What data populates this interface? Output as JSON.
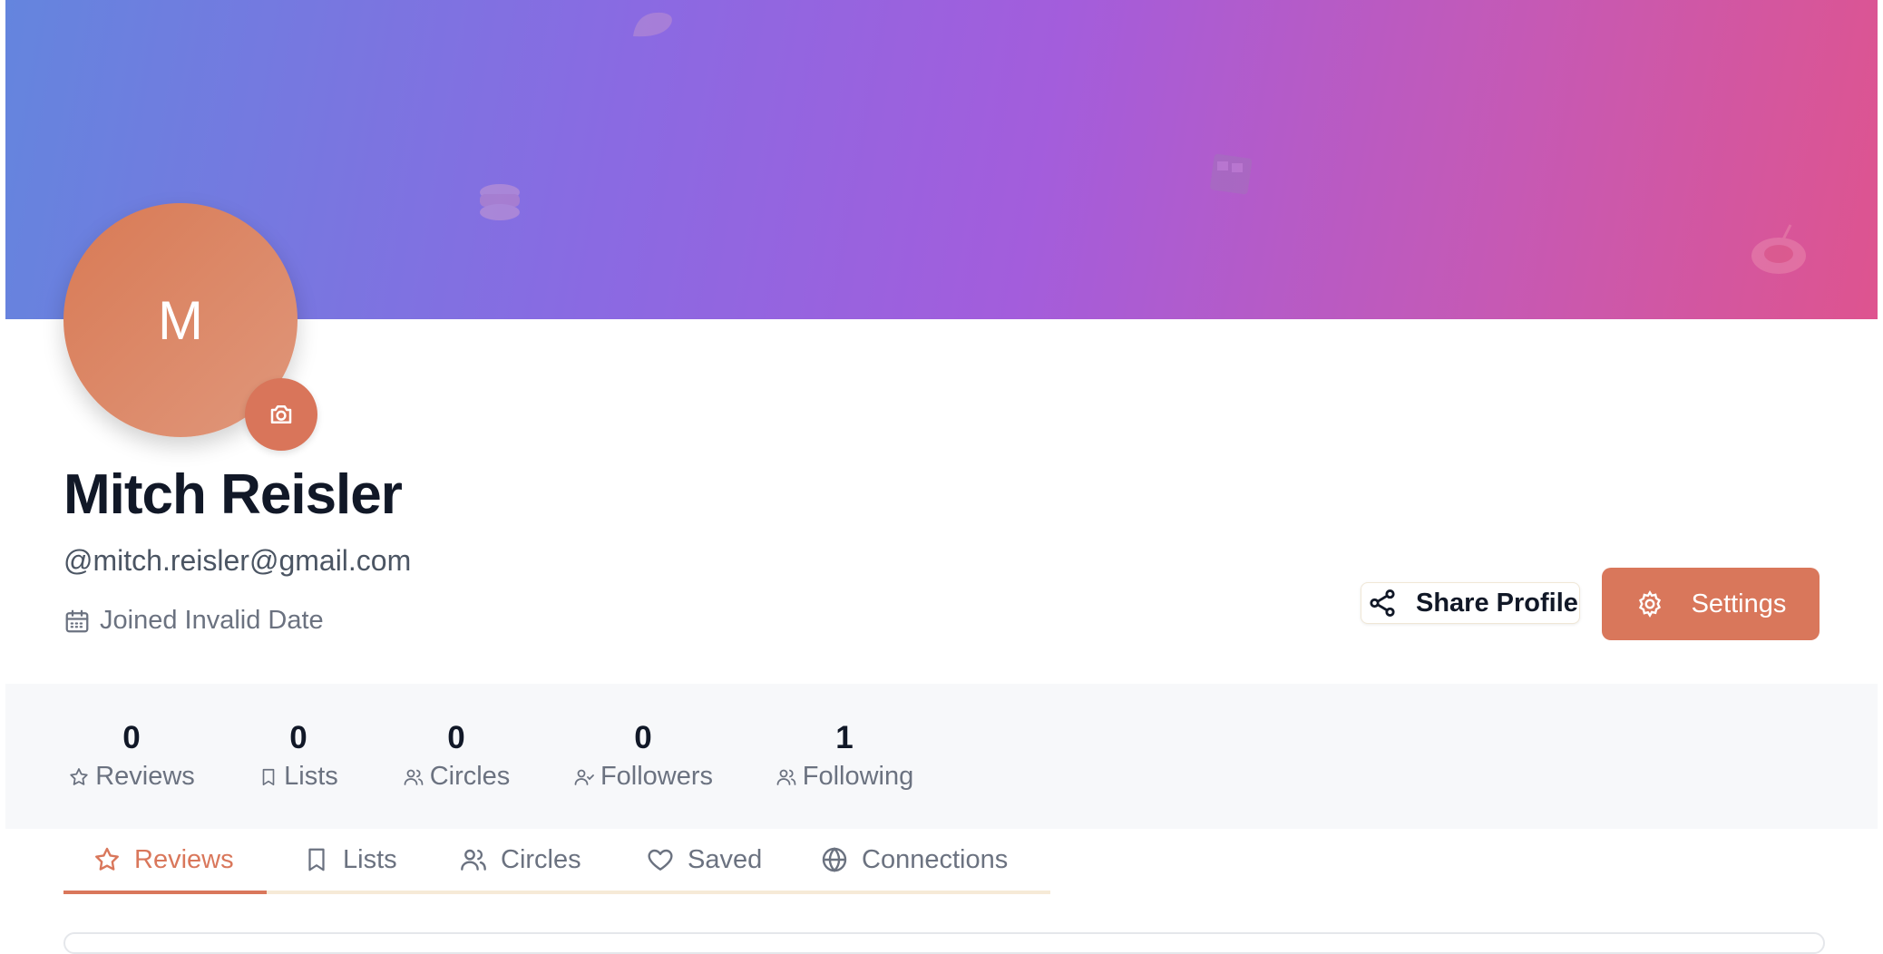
{
  "profile": {
    "avatar_initial": "M",
    "name": "Mitch Reisler",
    "handle": "@mitch.reisler@gmail.com",
    "joined": "Joined Invalid Date"
  },
  "actions": {
    "share_label": "Share Profile",
    "settings_label": "Settings"
  },
  "stats": [
    {
      "value": "0",
      "label": "Reviews"
    },
    {
      "value": "0",
      "label": "Lists"
    },
    {
      "value": "0",
      "label": "Circles"
    },
    {
      "value": "0",
      "label": "Followers"
    },
    {
      "value": "1",
      "label": "Following"
    }
  ],
  "tabs": [
    {
      "label": "Reviews",
      "active": true
    },
    {
      "label": "Lists",
      "active": false
    },
    {
      "label": "Circles",
      "active": false
    },
    {
      "label": "Saved",
      "active": false
    },
    {
      "label": "Connections",
      "active": false
    }
  ],
  "colors": {
    "accent": "#d9775b",
    "banner_start": "#6485de",
    "banner_end": "#de548f"
  }
}
